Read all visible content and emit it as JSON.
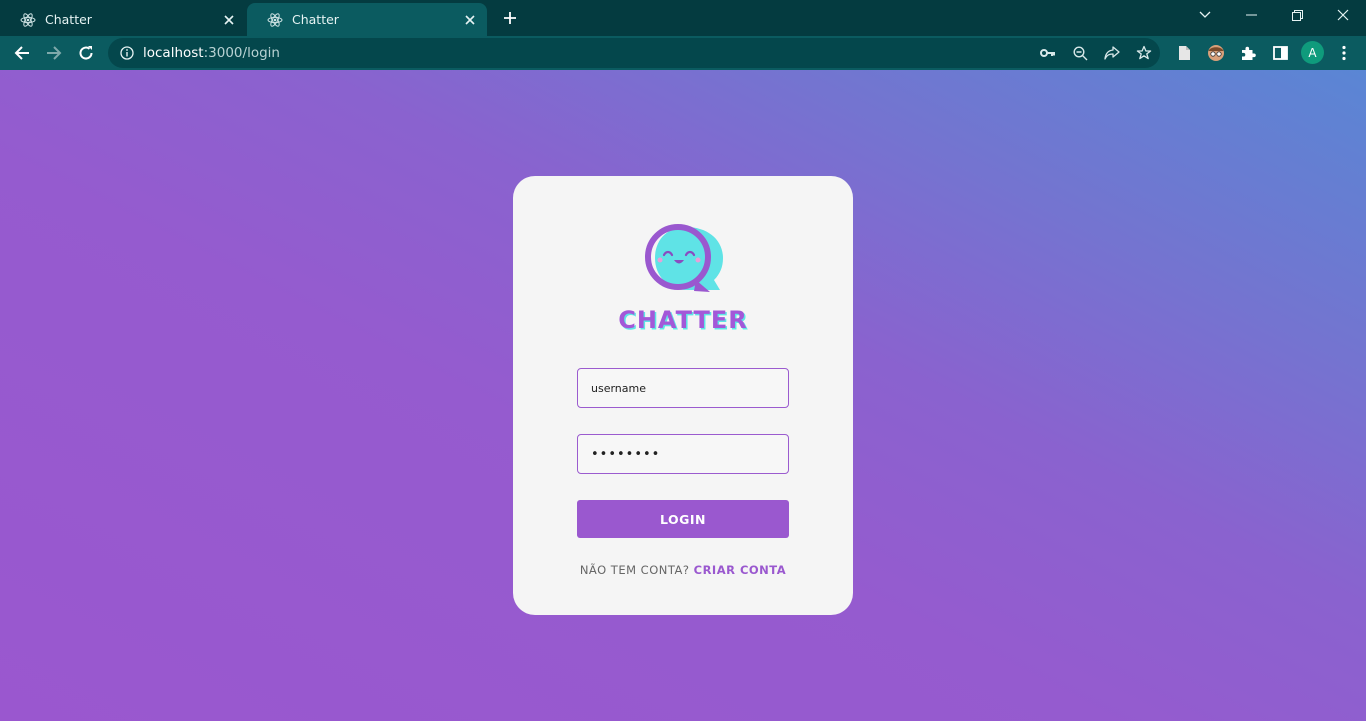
{
  "browser": {
    "tabs": [
      {
        "title": "Chatter",
        "active": false
      },
      {
        "title": "Chatter",
        "active": true
      }
    ],
    "address": {
      "host": "localhost",
      "path": ":3000/login"
    },
    "profile_initial": "A"
  },
  "login": {
    "brand": "CHATTER",
    "username_value": "username",
    "password_value": "••••••••",
    "login_label": "LOGIN",
    "no_account_text": "NÃO TEM CONTA?",
    "create_account_label": "CRIAR CONTA"
  },
  "colors": {
    "accent": "#9a58cf",
    "brand_shadow": "#5ee6e6",
    "chrome_bg": "#043b40",
    "toolbar_bg": "#0b5b60"
  }
}
